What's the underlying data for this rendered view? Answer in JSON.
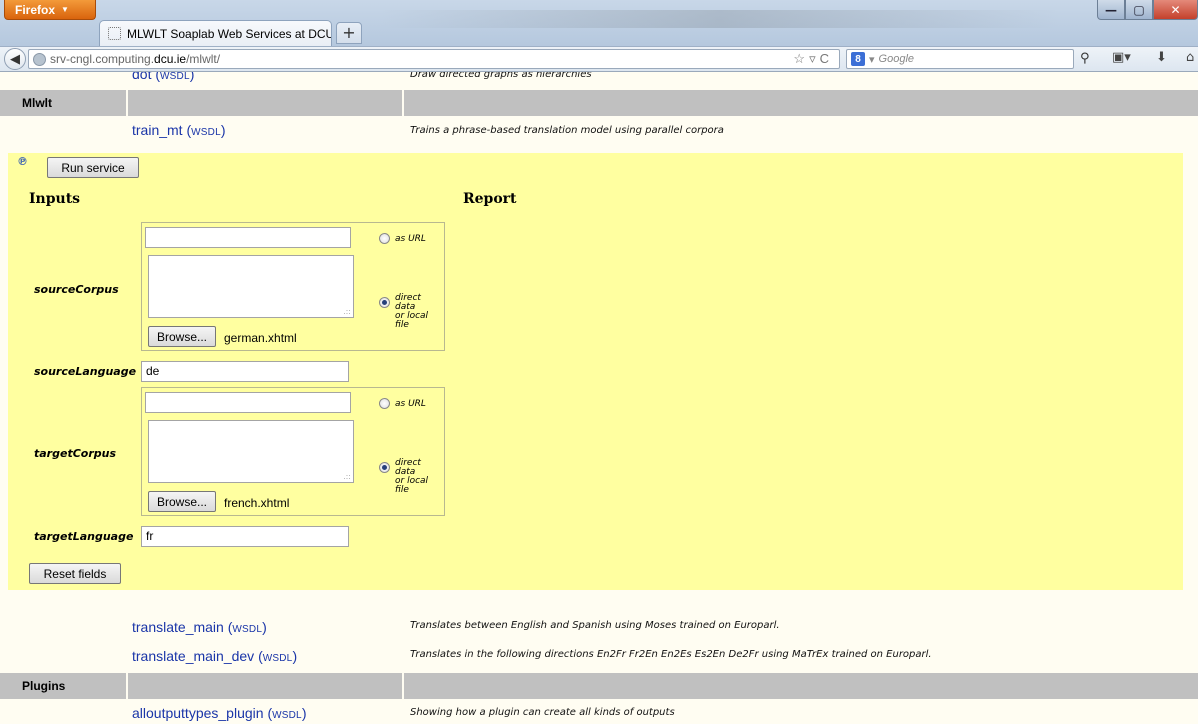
{
  "browser": {
    "app_button": "Firefox",
    "tab_title": "MLWLT Soaplab Web Services at DCU",
    "new_tab": "+",
    "url_prefix": "srv-cngl.computing.",
    "url_domain": "dcu.ie",
    "url_path": "/mlwlt/",
    "search_engine_letter": "8",
    "search_placeholder": "Google"
  },
  "services_top": {
    "partial_service": "dot",
    "partial_desc": "Draw directed graphs as hierarchies"
  },
  "categories": {
    "mlwlt": "Mlwlt",
    "plugins": "Plugins"
  },
  "wsdl_label": "wsdl",
  "services": {
    "train_mt": {
      "name": "train_mt",
      "desc": "Trains a phrase-based translation model using parallel corpora"
    },
    "translate_main": {
      "name": "translate_main",
      "desc": "Translates between English and Spanish using Moses trained on Europarl."
    },
    "translate_main_dev": {
      "name": "translate_main_dev",
      "desc": "Translates in the following directions En2Fr Fr2En En2Es Es2En De2Fr using MaTrEx trained on Europarl."
    },
    "alloutputtypes_plugin": {
      "name": "alloutputtypes_plugin",
      "desc": "Showing how a plugin can create all kinds of outputs"
    }
  },
  "form": {
    "run_button": "Run service",
    "inputs_heading": "Inputs",
    "report_heading": "Report",
    "as_url": "as URL",
    "direct_data_line1": "direct data",
    "direct_data_line2": "or local file",
    "browse_button": "Browse...",
    "reset_button": "Reset fields",
    "params": {
      "source_corpus": {
        "label": "sourceCorpus",
        "url_value": "",
        "file": "german.xhtml"
      },
      "source_language": {
        "label": "sourceLanguage",
        "value": "de"
      },
      "target_corpus": {
        "label": "targetCorpus",
        "url_value": "",
        "file": "french.xhtml"
      },
      "target_language": {
        "label": "targetLanguage",
        "value": "fr"
      }
    }
  }
}
